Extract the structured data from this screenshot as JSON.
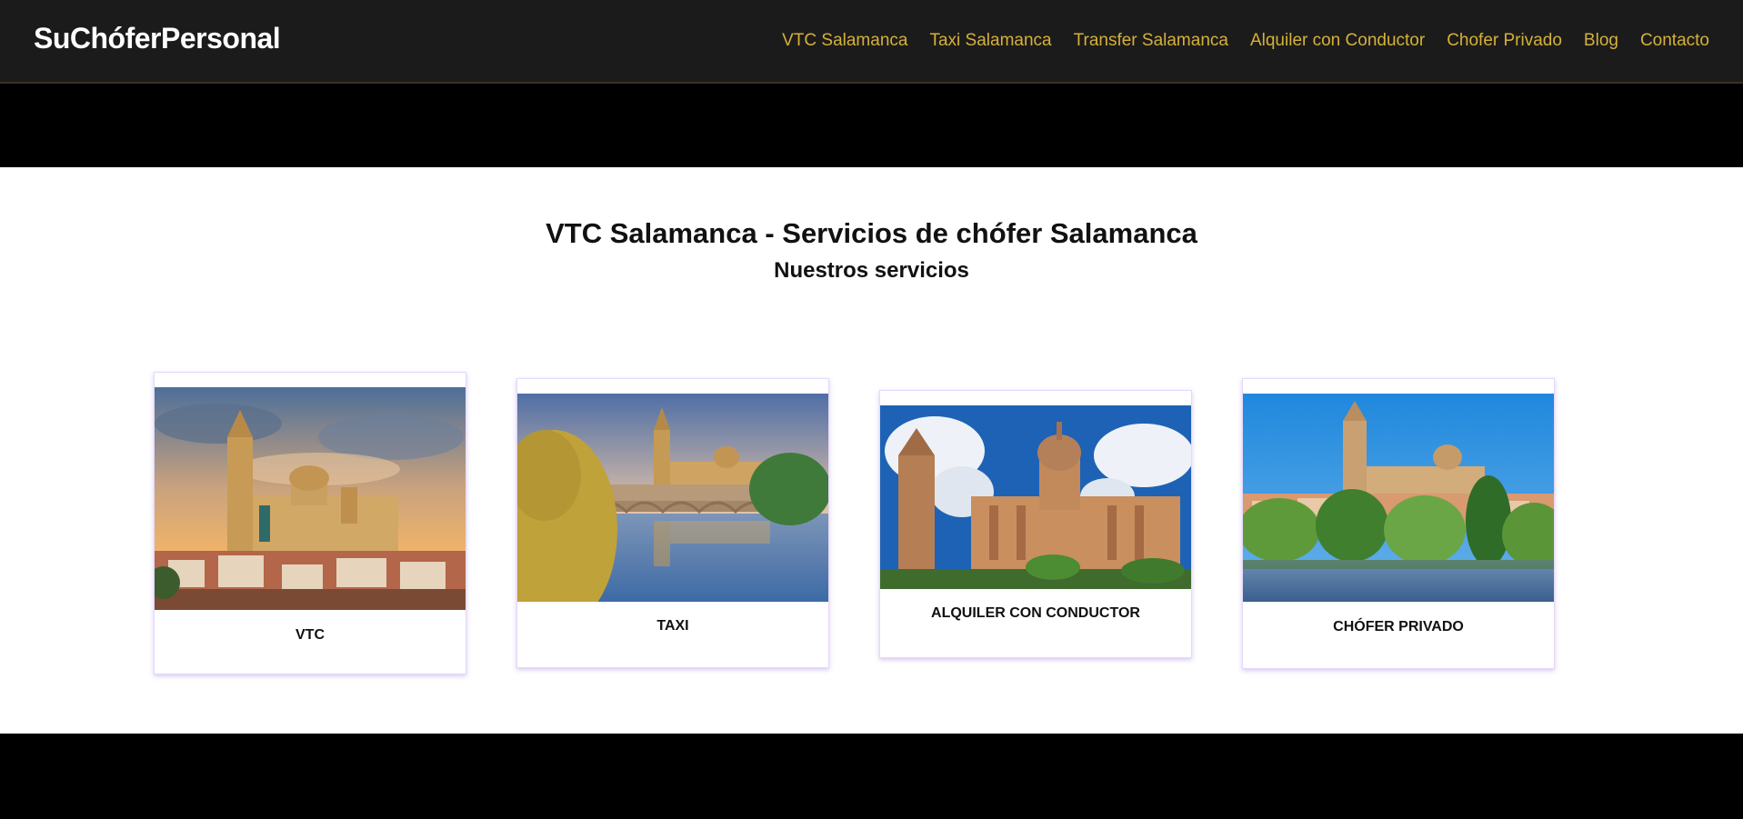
{
  "header": {
    "logo": "SuChóferPersonal",
    "nav": [
      {
        "label": "VTC Salamanca"
      },
      {
        "label": "Taxi Salamanca"
      },
      {
        "label": "Transfer Salamanca"
      },
      {
        "label": "Alquiler con Conductor"
      },
      {
        "label": "Chofer Privado"
      },
      {
        "label": "Blog"
      },
      {
        "label": "Contacto"
      }
    ]
  },
  "main": {
    "title": "VTC Salamanca - Servicios de chófer Salamanca",
    "subtitle": "Nuestros servicios"
  },
  "services": [
    {
      "label": "VTC",
      "image": "cathedral-sunset-photo"
    },
    {
      "label": "TAXI",
      "image": "bridge-river-photo"
    },
    {
      "label": "ALQUILER CON CONDUCTOR",
      "image": "cathedral-blue-sky-photo"
    },
    {
      "label": "CHÓFER PRIVADO",
      "image": "city-river-trees-photo"
    }
  ],
  "colors": {
    "header_bg": "#1c1b1b",
    "nav_link": "#d4b13a",
    "band": "#000000",
    "card_border": "#e4d8f8"
  }
}
